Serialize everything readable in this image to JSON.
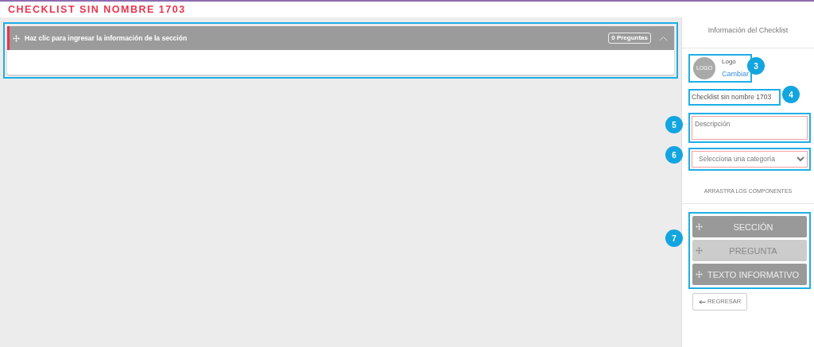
{
  "page_title": "CHECKLIST SIN NOMBRE 1703",
  "section": {
    "title": "Haz clic para ingresar la información de la sección",
    "badge": "0 Preguntas",
    "expanded": true
  },
  "sidebar": {
    "title": "Información del Checklist",
    "logo_placeholder": "LOGO",
    "logo_label": "Logo",
    "logo_link": "Cambiar",
    "name_value": "Checklist sin nombre 1703",
    "description_placeholder": "Descripción",
    "category_placeholder": "Selecciona una categoría",
    "components_title": "ARRASTRA LOS COMPONENTES",
    "components": [
      {
        "label": "SECCIÓN",
        "disabled": false
      },
      {
        "label": "PREGUNTA",
        "disabled": true
      },
      {
        "label": "TEXTO INFORMATIVO",
        "disabled": false
      }
    ],
    "back_button": "REGRESAR"
  },
  "callouts": [
    "3",
    "4",
    "5",
    "6",
    "7"
  ]
}
